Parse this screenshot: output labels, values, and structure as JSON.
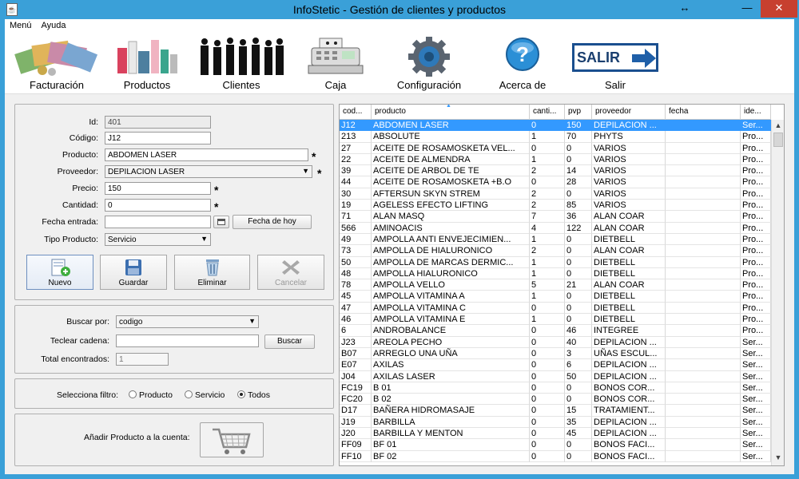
{
  "window": {
    "title": "InfoStetic - Gestión de clientes y productos",
    "restore_glyph": "↔",
    "minimize_glyph": "—",
    "maximize_glyph": "▭",
    "close_glyph": "✕"
  },
  "menu": [
    "Menú",
    "Ayuda"
  ],
  "toolbar": [
    {
      "label": "Facturación",
      "icon": "money-icon"
    },
    {
      "label": "Productos",
      "icon": "products-icon"
    },
    {
      "label": "Clientes",
      "icon": "clients-icon"
    },
    {
      "label": "Caja",
      "icon": "cash-register-icon"
    },
    {
      "label": "Configuración",
      "icon": "gear-icon"
    },
    {
      "label": "Acerca de",
      "icon": "help-icon"
    },
    {
      "label": "Salir",
      "icon": "exit-icon",
      "text": "SALIR"
    }
  ],
  "form": {
    "id_label": "Id:",
    "id_value": "401",
    "codigo_label": "Código:",
    "codigo_value": "J12",
    "producto_label": "Producto:",
    "producto_value": "ABDOMEN LASER",
    "proveedor_label": "Proveedor:",
    "proveedor_value": "DEPILACION LASER",
    "precio_label": "Precio:",
    "precio_value": "150",
    "cantidad_label": "Cantidad:",
    "cantidad_value": "0",
    "fecha_label": "Fecha entrada:",
    "fecha_value": "",
    "fecha_hoy_button": "Fecha de hoy",
    "tipo_label": "Tipo Producto:",
    "tipo_value": "Servicio",
    "required_mark": "*",
    "buttons": {
      "nuevo": "Nuevo",
      "guardar": "Guardar",
      "eliminar": "Eliminar",
      "cancelar": "Cancelar"
    }
  },
  "search": {
    "buscar_por_label": "Buscar por:",
    "buscar_por_value": "codigo",
    "teclear_label": "Teclear cadena:",
    "teclear_value": "",
    "buscar_button": "Buscar",
    "total_label": "Total encontrados:",
    "total_value": "1"
  },
  "filter": {
    "label": "Selecciona filtro:",
    "options": [
      "Producto",
      "Servicio",
      "Todos"
    ],
    "selected": "Todos"
  },
  "add_to_account": {
    "label": "Añadir Producto a la cuenta:",
    "icon": "cart-icon"
  },
  "table": {
    "columns": [
      "cod...",
      "producto",
      "canti...",
      "pvp",
      "proveedor",
      "fecha",
      "ide..."
    ],
    "rows": [
      [
        "J12",
        "ABDOMEN LASER",
        "0",
        "150",
        "DEPILACION ...",
        "",
        "Ser..."
      ],
      [
        "213",
        "ABSOLUTE",
        "1",
        "70",
        "PHYTS",
        "",
        "Pro..."
      ],
      [
        "27",
        "ACEITE DE ROSAMOSKETA VEL...",
        "0",
        "0",
        "VARIOS",
        "",
        "Pro..."
      ],
      [
        "22",
        "ACEITE DE ALMENDRA",
        "1",
        "0",
        "VARIOS",
        "",
        "Pro..."
      ],
      [
        "39",
        "ACEITE DE ARBOL DE TE",
        "2",
        "14",
        "VARIOS",
        "",
        "Pro..."
      ],
      [
        "44",
        "ACEITE DE ROSAMOSKETA +B.O",
        "0",
        "28",
        "VARIOS",
        "",
        "Pro..."
      ],
      [
        "30",
        "AFTERSUN SKYN STREM",
        "2",
        "0",
        "VARIOS",
        "",
        "Pro..."
      ],
      [
        "19",
        "AGELESS EFECTO LIFTING",
        "2",
        "85",
        "VARIOS",
        "",
        "Pro..."
      ],
      [
        "71",
        "ALAN MASQ",
        "7",
        "36",
        "ALAN COAR",
        "",
        "Pro..."
      ],
      [
        "566",
        "AMINOACIS",
        "4",
        "122",
        "ALAN COAR",
        "",
        "Pro..."
      ],
      [
        "49",
        "AMPOLLA ANTI ENVEJECIMIEN...",
        "1",
        "0",
        "DIETBELL",
        "",
        "Pro..."
      ],
      [
        "73",
        "AMPOLLA DE HIALURONICO",
        "2",
        "0",
        "ALAN COAR",
        "",
        "Pro..."
      ],
      [
        "50",
        "AMPOLLA DE MARCAS DERMIC...",
        "1",
        "0",
        "DIETBELL",
        "",
        "Pro..."
      ],
      [
        "48",
        "AMPOLLA HIALURONICO",
        "1",
        "0",
        "DIETBELL",
        "",
        "Pro..."
      ],
      [
        "78",
        "AMPOLLA VELLO",
        "5",
        "21",
        "ALAN COAR",
        "",
        "Pro..."
      ],
      [
        "45",
        "AMPOLLA VITAMINA A",
        "1",
        "0",
        "DIETBELL",
        "",
        "Pro..."
      ],
      [
        "47",
        "AMPOLLA VITAMINA C",
        "0",
        "0",
        "DIETBELL",
        "",
        "Pro..."
      ],
      [
        "46",
        "AMPOLLA VITAMINA E",
        "1",
        "0",
        "DIETBELL",
        "",
        "Pro..."
      ],
      [
        "6",
        "ANDROBALANCE",
        "0",
        "46",
        "INTEGREE",
        "",
        "Pro..."
      ],
      [
        "J23",
        "AREOLA PECHO",
        "0",
        "40",
        "DEPILACION ...",
        "",
        "Ser..."
      ],
      [
        "B07",
        "ARREGLO UNA UÑA",
        "0",
        "3",
        "UÑAS ESCUL...",
        "",
        "Ser..."
      ],
      [
        "E07",
        "AXILAS",
        "0",
        "6",
        "DEPILACION ...",
        "",
        "Ser..."
      ],
      [
        "J04",
        "AXILAS LASER",
        "0",
        "50",
        "DEPILACION ...",
        "",
        "Ser..."
      ],
      [
        "FC19",
        "B 01",
        "0",
        "0",
        "BONOS COR...",
        "",
        "Ser..."
      ],
      [
        "FC20",
        "B 02",
        "0",
        "0",
        "BONOS COR...",
        "",
        "Ser..."
      ],
      [
        "D17",
        "BAÑERA HIDROMASAJE",
        "0",
        "15",
        "TRATAMIENT...",
        "",
        "Ser..."
      ],
      [
        "J19",
        "BARBILLA",
        "0",
        "35",
        "DEPILACION ...",
        "",
        "Ser..."
      ],
      [
        "J20",
        "BARBILLA Y MENTON",
        "0",
        "45",
        "DEPILACION ...",
        "",
        "Ser..."
      ],
      [
        "FF09",
        "BF 01",
        "0",
        "0",
        "BONOS FACI...",
        "",
        "Ser..."
      ],
      [
        "FF10",
        "BF 02",
        "0",
        "0",
        "BONOS FACI...",
        "",
        "Ser..."
      ]
    ],
    "selected_row": 0
  }
}
